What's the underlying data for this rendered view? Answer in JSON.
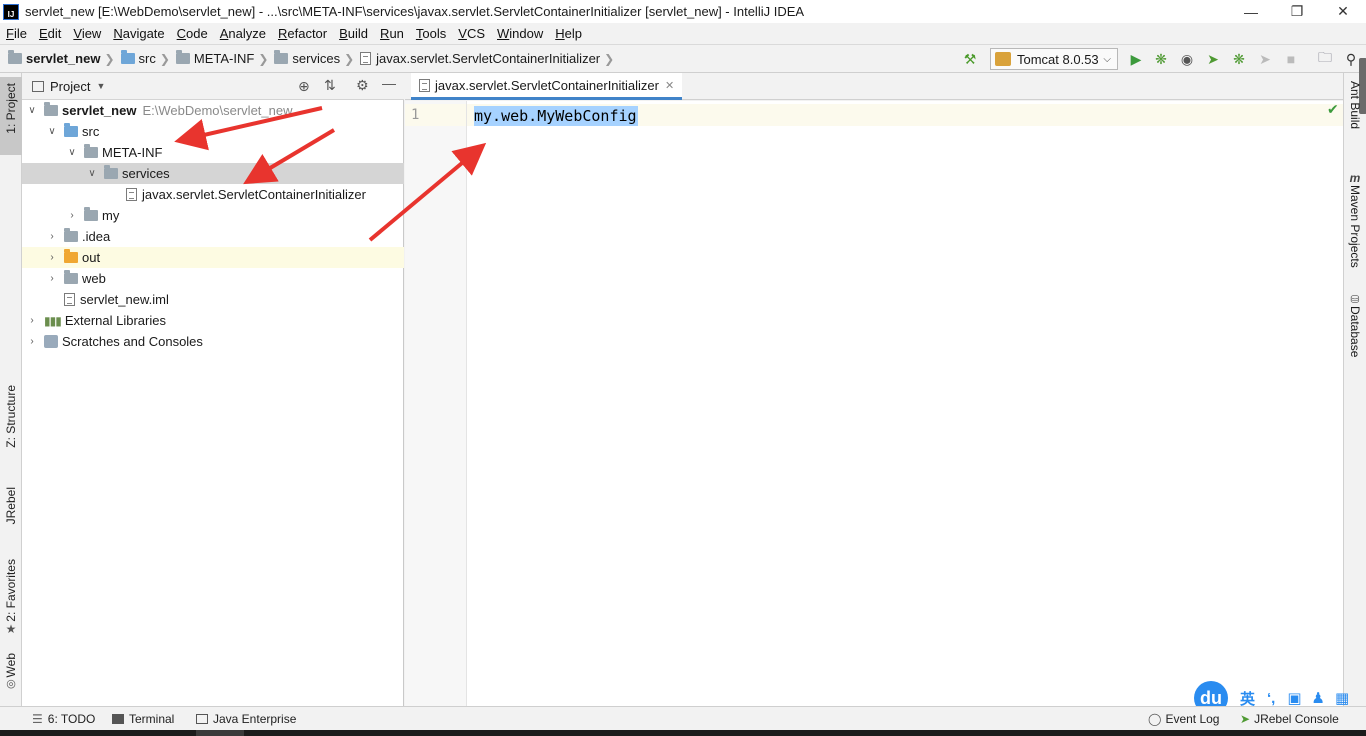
{
  "window": {
    "title": "servlet_new [E:\\WebDemo\\servlet_new] - ...\\src\\META-INF\\services\\javax.servlet.ServletContainerInitializer [servlet_new] - IntelliJ IDEA",
    "logo_text": "IJ"
  },
  "menu": [
    "File",
    "Edit",
    "View",
    "Navigate",
    "Code",
    "Analyze",
    "Refactor",
    "Build",
    "Run",
    "Tools",
    "VCS",
    "Window",
    "Help"
  ],
  "breadcrumb": {
    "project": "servlet_new",
    "src": "src",
    "meta_inf": "META-INF",
    "services": "services",
    "file": "javax.servlet.ServletContainerInitializer"
  },
  "run_config": {
    "label": "Tomcat 8.0.53"
  },
  "left_tabs": {
    "project": "1: Project",
    "structure": "Z: Structure",
    "jrebel": "JRebel",
    "favorites": "2: Favorites",
    "web": "Web"
  },
  "right_tabs": {
    "ant": "Ant Build",
    "maven": "Maven Projects",
    "database": "Database"
  },
  "project_panel": {
    "title": "Project",
    "tree": {
      "root_name": "servlet_new",
      "root_path": "E:\\WebDemo\\servlet_new",
      "src": "src",
      "meta_inf": "META-INF",
      "services": "services",
      "file": "javax.servlet.ServletContainerInitializer",
      "my": "my",
      "idea": ".idea",
      "out": "out",
      "web": "web",
      "iml": "servlet_new.iml",
      "ext_libs": "External Libraries",
      "scratches": "Scratches and Consoles"
    }
  },
  "editor": {
    "tab_label": "javax.servlet.ServletContainerInitializer",
    "line_number": "1",
    "code": "my.web.MyWebConfig"
  },
  "bottom": {
    "todo": "6: TODO",
    "terminal": "Terminal",
    "java_enterprise": "Java Enterprise",
    "event_log": "Event Log",
    "jrebel_console": "JRebel Console"
  },
  "ime": {
    "logo": "du",
    "lang": "英"
  },
  "colors": {
    "selection": "#a6d2ff",
    "caret_line": "#fcfaed",
    "arrow": "#e8342e",
    "tab_underline": "#4083c9"
  }
}
